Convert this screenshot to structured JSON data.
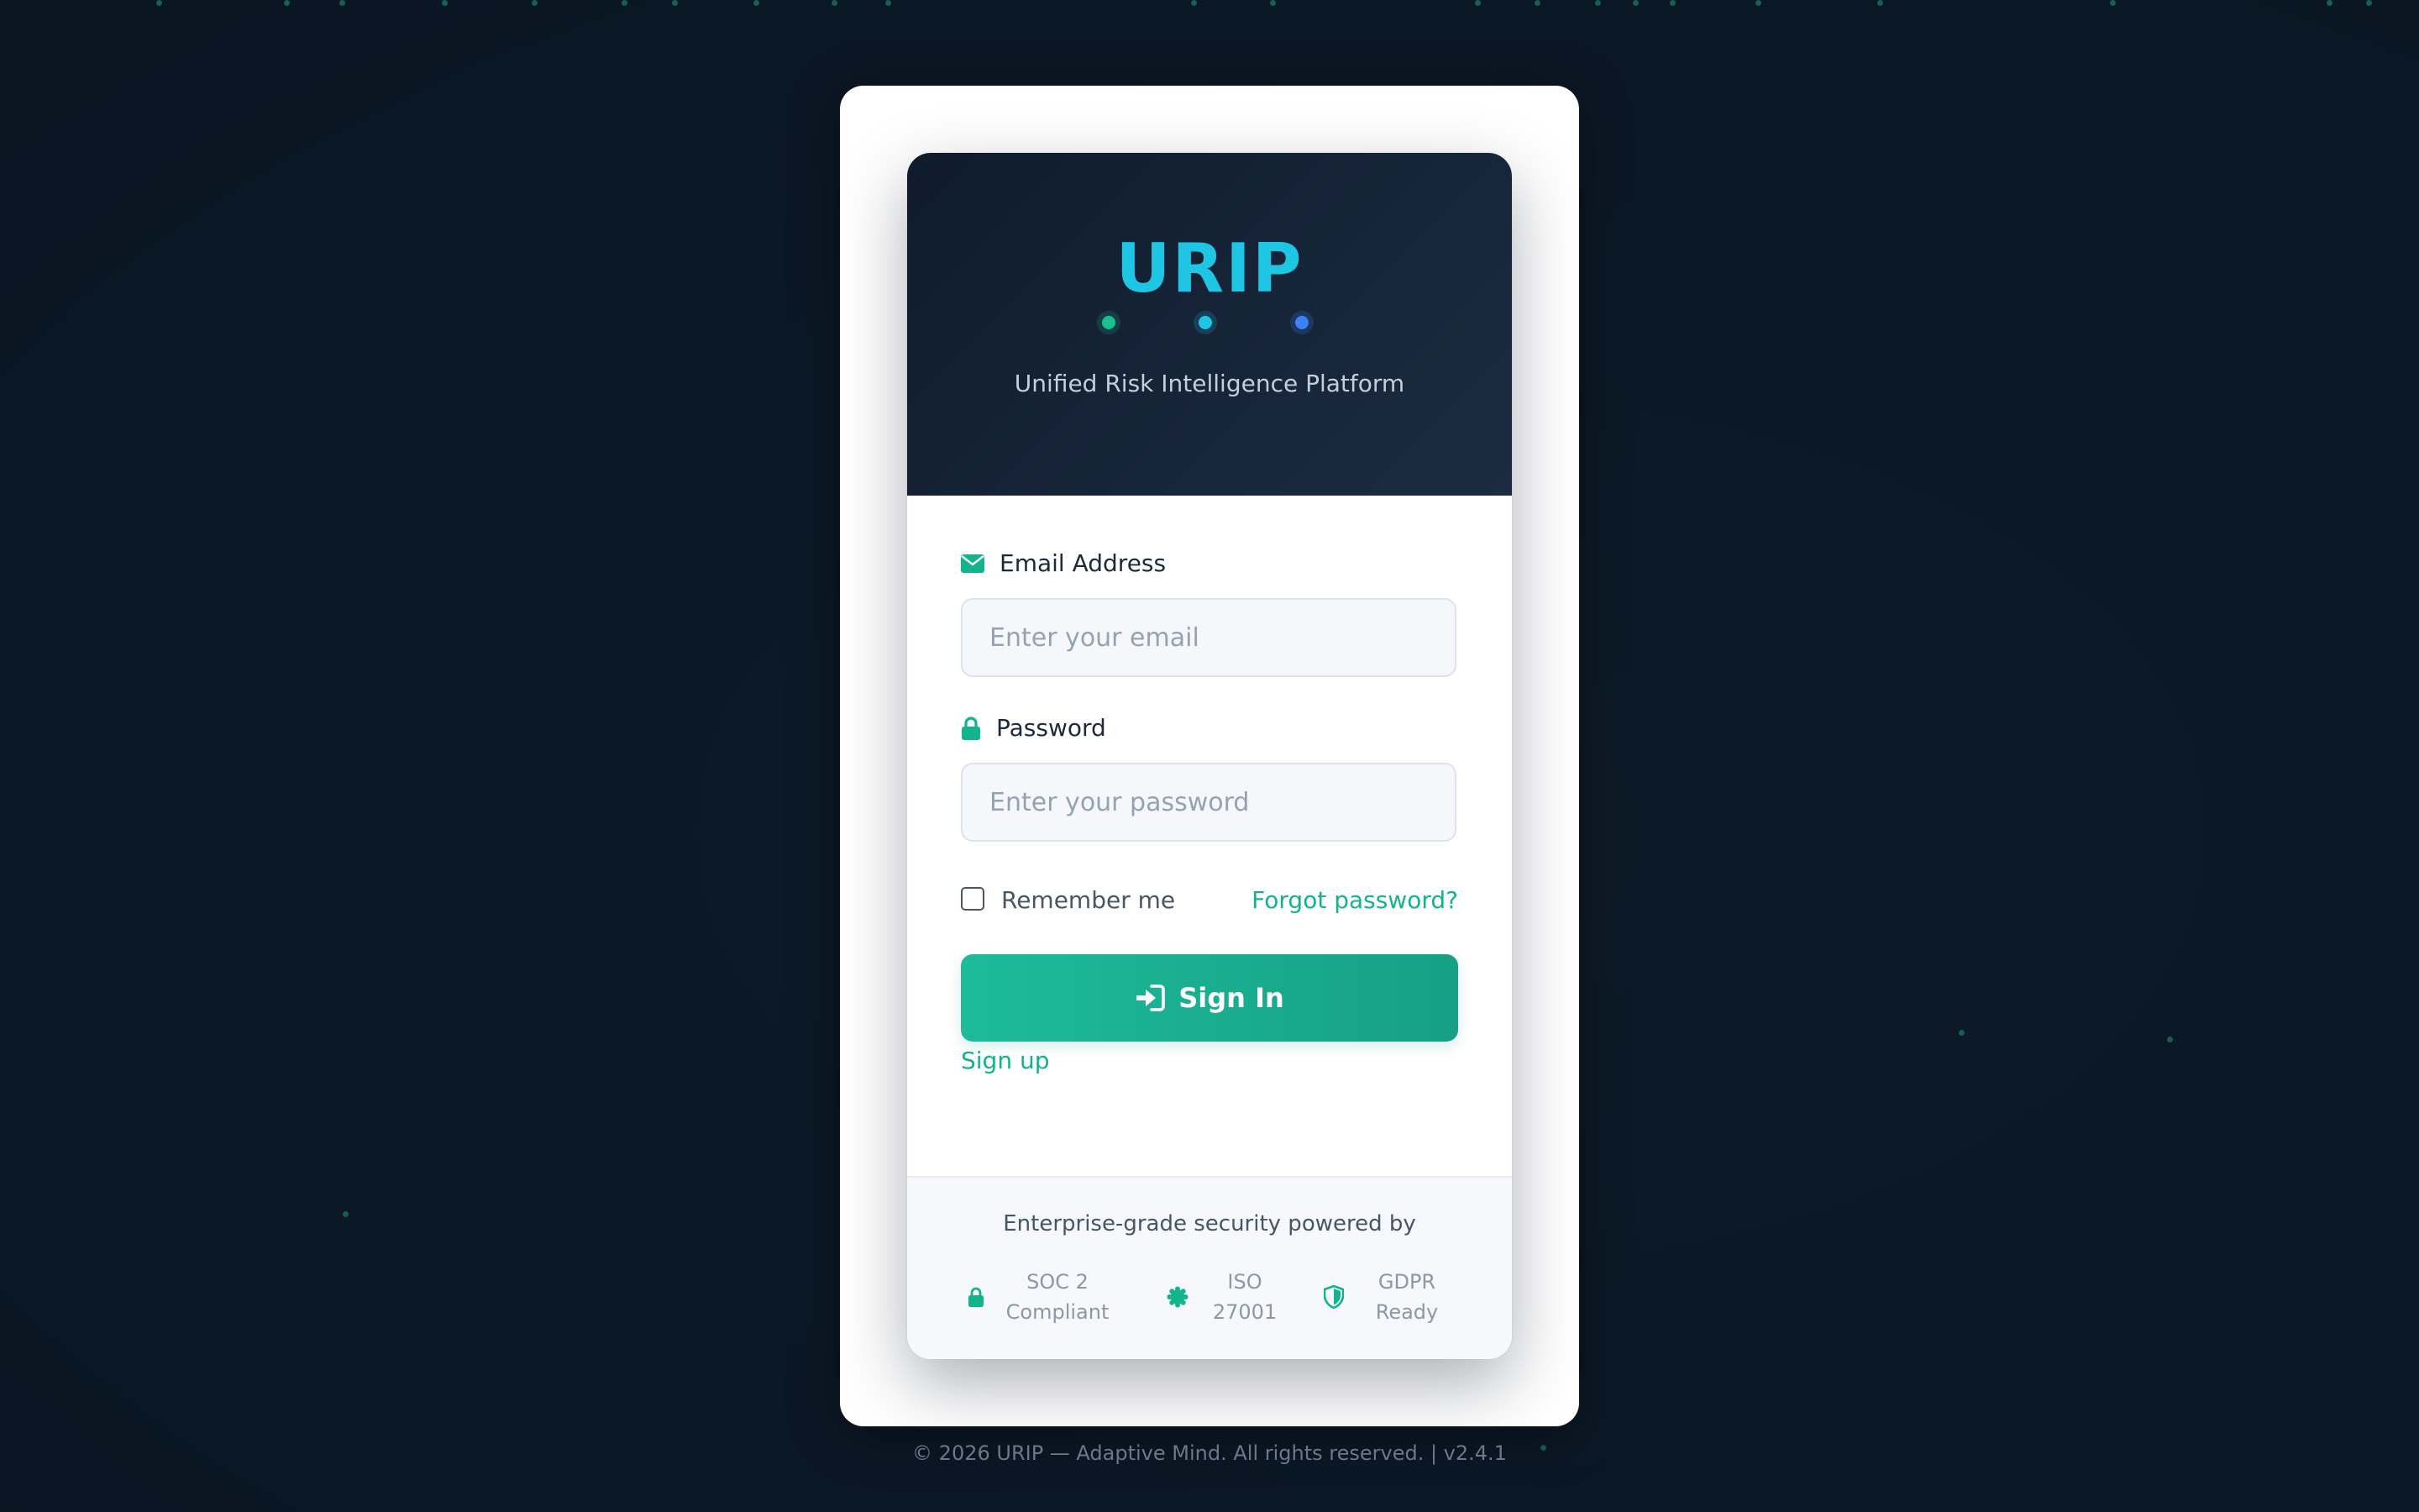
{
  "brand": {
    "title": "URIP",
    "tagline": "Unified Risk Intelligence Platform",
    "dot_colors": [
      "#1bbf8d",
      "#1ec6e4",
      "#3b82f6"
    ]
  },
  "form": {
    "email": {
      "label": "Email Address",
      "placeholder": "Enter your email",
      "value": "",
      "icon": "envelope-icon"
    },
    "password": {
      "label": "Password",
      "placeholder": "Enter your password",
      "value": "",
      "icon": "lock-icon"
    },
    "remember_label": "Remember me",
    "remember_checked": false,
    "forgot_label": "Forgot password?",
    "signin_label": "Sign In",
    "signin_icon": "sign-in-icon",
    "signup_label": "Sign up"
  },
  "footer": {
    "caption": "Enterprise-grade security powered by",
    "badges": [
      {
        "icon": "lock-icon",
        "line1": "SOC 2",
        "line2": "Compliant"
      },
      {
        "icon": "certificate-icon",
        "line1": "ISO",
        "line2": "27001"
      },
      {
        "icon": "shield-icon",
        "line1": "GDPR",
        "line2": "Ready"
      }
    ]
  },
  "copyright": "© 2026 URIP — Adaptive Mind. All rights reserved. | v2.4.1",
  "colors": {
    "accent": "#12b48c",
    "brand_title": "#1ec6e4",
    "background": "#0b1826",
    "header_bg": "#0f1b2d"
  }
}
